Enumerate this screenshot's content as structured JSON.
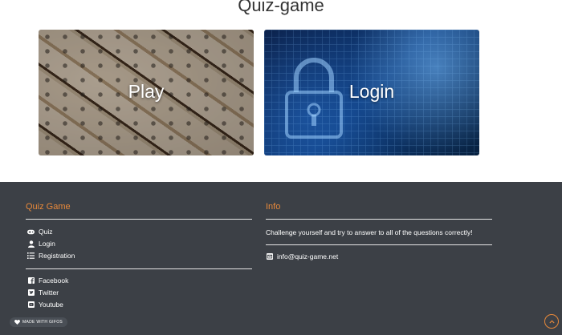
{
  "page": {
    "title": "Quiz-game"
  },
  "cards": {
    "play": {
      "label": "Play"
    },
    "login": {
      "label": "Login"
    }
  },
  "footer": {
    "col1": {
      "heading": "Quiz Game",
      "nav": [
        {
          "label": "Quiz",
          "icon": "gamepad-icon"
        },
        {
          "label": "Login",
          "icon": "user-icon"
        },
        {
          "label": "Registration",
          "icon": "list-icon"
        }
      ],
      "social": [
        {
          "label": "Facebook",
          "icon": "facebook-icon"
        },
        {
          "label": "Twitter",
          "icon": "twitter-icon"
        },
        {
          "label": "Youtube",
          "icon": "youtube-icon"
        }
      ]
    },
    "col2": {
      "heading": "Info",
      "text": "Challenge yourself and try to answer to all of the questions correctly!",
      "email": "info@quiz-game.net",
      "email_icon": "envelope-icon"
    },
    "badge": "MADE WITH GIFOS",
    "accent": "#e8893a"
  }
}
